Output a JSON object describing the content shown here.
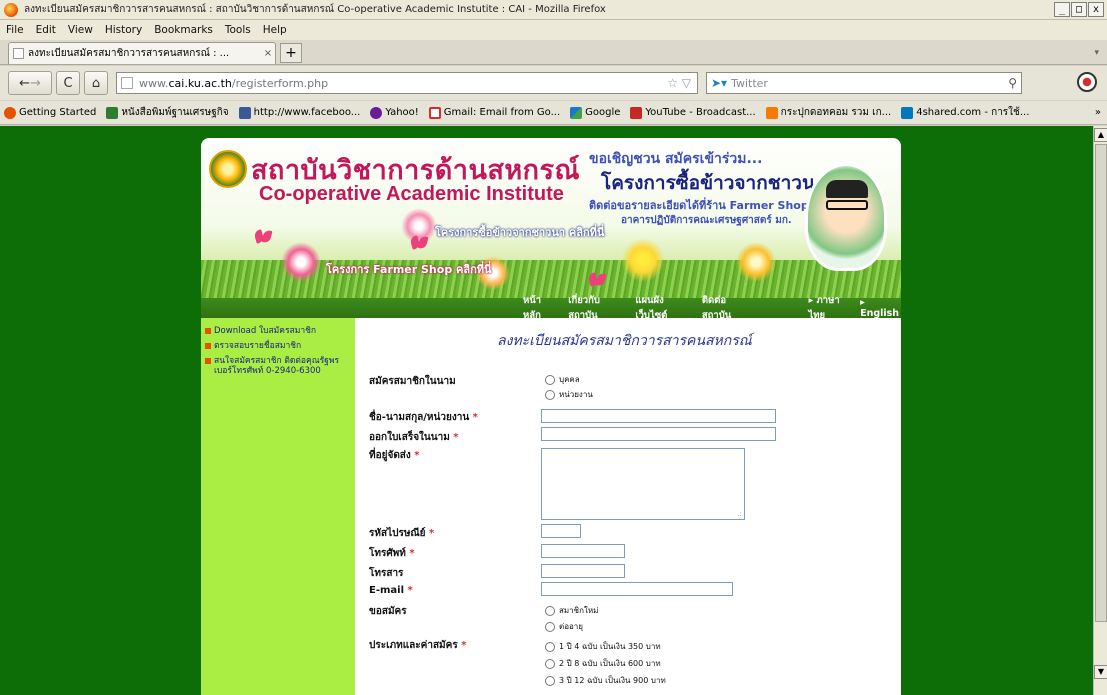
{
  "window": {
    "title": "ลงทะเบียนสมัครสมาชิกวารสารคนสหกรณ์ : สถาบันวิชาการด้านสหกรณ์ Co-operative Academic Instutite : CAI - Mozilla Firefox",
    "buttons": [
      "_",
      "□",
      "x"
    ]
  },
  "menu": [
    "File",
    "Edit",
    "View",
    "History",
    "Bookmarks",
    "Tools",
    "Help"
  ],
  "tab": {
    "title": "ลงทะเบียนสมัครสมาชิกวารสารคนสหกรณ์ : ...",
    "close": "×",
    "new": "+"
  },
  "nav": {
    "url_prefix": "www.",
    "url_host": "cai.ku.ac.th",
    "url_path": "/registerform.php",
    "search_placeholder": "Twitter",
    "back": "←",
    "forward": "→",
    "reload": "C",
    "home": "⌂",
    "star": "☆ ▽"
  },
  "bookmarks": [
    {
      "label": "Getting Started",
      "color": "#e65100"
    },
    {
      "label": "หนังสือพิมพ์ฐานเศรษฐกิจ",
      "color": "#2e7d32"
    },
    {
      "label": "http://www.faceboo...",
      "color": "#3b5998"
    },
    {
      "label": "Yahoo!",
      "color": "#6a1b9a"
    },
    {
      "label": "Gmail: Email from Go...",
      "color": "#d32f2f"
    },
    {
      "label": "Google",
      "color": "#1976d2"
    },
    {
      "label": "YouTube - Broadcast...",
      "color": "#c62828"
    },
    {
      "label": "กระปุกดอทคอม รวม เก...",
      "color": "#f57c00"
    },
    {
      "label": "4shared.com - การใช้...",
      "color": "#0277bd"
    }
  ],
  "bookmarks_more": "»",
  "banner": {
    "title_th": "สถาบันวิชาการด้านสหกรณ์",
    "title_en": "Co-operative Academic Institute",
    "invite": "ขอเชิญชวน สมัครเข้าร่วม...",
    "project": "โครงการซื้อข้าวจากชาวนา",
    "contact": "ติดต่อขอรายละเอียดได้ที่ร้าน Farmer Shop",
    "building": "อาคารปฏิบัติการคณะเศรษฐศาสตร์ มก.",
    "link_rice": "โครงการซื้อข้าวจากชาวนา คลิกที่นี่",
    "link_farmer": "โครงการ Farmer Shop คลิกที่นี่"
  },
  "topnav": {
    "home": "หน้าหลัก",
    "about": "เกี่ยวกับสถาบัน",
    "sitemap": "แผนผังเว็บไซต์",
    "contact": "ติดต่อสถาบัน",
    "thai": "▸ ภาษาไทย",
    "english": "▸ English"
  },
  "sidebar": {
    "items": [
      "Download ใบสมัครสมาชิก",
      "ตรวจสอบรายชื่อสมาชิก",
      "สนใจสมัครสมาชิก ติดต่อคุณรัฐพร เบอร์โทรศัพท์ 0-2940-6300"
    ]
  },
  "form": {
    "title": "ลงทะเบียนสมัครสมาชิกวารสารคนสหกรณ์",
    "apply_in_name_label": "สมัครสมาชิกในนาม",
    "apply_in_name_options": [
      "บุคคล",
      "หน่วยงาน"
    ],
    "name_label": "ชื่อ-นามสกุล/หน่วยงาน",
    "receipt_label": "ออกใบเสร็จในนาม",
    "address_label": "ที่อยู่จัดส่ง",
    "zip_label": "รหัสไปรษณีย์",
    "phone_label": "โทรศัพท์",
    "fax_label": "โทรสาร",
    "email_label": "E-mail",
    "request_label": "ขอสมัคร",
    "request_options": [
      "สมาชิกใหม่",
      "ต่ออายุ"
    ],
    "type_label": "ประเภทและค่าสมัคร",
    "type_options": [
      "1 ปี 4 ฉบับ เป็นเงิน 350 บาท",
      "2 ปี 8 ฉบับ เป็นเงิน 600 บาท",
      "3 ปี 12 ฉบับ เป็นเงิน 900 บาท"
    ],
    "required_mark": "*"
  }
}
